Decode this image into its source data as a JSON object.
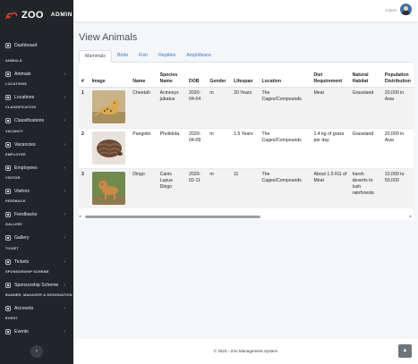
{
  "brand": {
    "logo": "ZOO",
    "admin_label": "ADMIN"
  },
  "topbar": {
    "user_name": "Admin"
  },
  "sidebar": {
    "dashboard": "Dashboard",
    "sections": [
      {
        "heading": "ANIMALS",
        "item": "Animals"
      },
      {
        "heading": "LOCATIONS",
        "item": "Locations"
      },
      {
        "heading": "CLASSIFICATION",
        "item": "Classifications"
      },
      {
        "heading": "VACANCY",
        "item": "Vacancies"
      },
      {
        "heading": "EMPLOYEE",
        "item": "Employees"
      },
      {
        "heading": "VISITOR",
        "item": "Visitors"
      },
      {
        "heading": "FEEDBACK",
        "item": "Feedbacks"
      },
      {
        "heading": "GALLERY",
        "item": "Gallery"
      },
      {
        "heading": "TICKET",
        "item": "Tickets"
      },
      {
        "heading": "SPONSORSHIP SCHEME",
        "item": "Sponsorship Scheme"
      },
      {
        "heading": "BANNER, MANAGER & DESIGNATION",
        "item": "Accounts"
      },
      {
        "heading": "EVENT",
        "item": "Events"
      }
    ],
    "collapse_glyph": "‹"
  },
  "page": {
    "title": "View Animals",
    "tabs": [
      "Mammals",
      "Birds",
      "Fish",
      "Reptiles",
      "Amphibians"
    ],
    "active_tab": 0
  },
  "table": {
    "headers": [
      "#",
      "Image",
      "Name",
      "Species Name",
      "DOB",
      "Gender",
      "Lifespan",
      "Location",
      "Diet Requirement",
      "Natural Habitat",
      "Population Distribution"
    ],
    "rows": [
      {
        "num": "1",
        "image": "cheetah",
        "name": "Cheetah",
        "species": "Acinonyx jubatus",
        "dob": "2020-04-04",
        "gender": "m",
        "lifespan": "20 Years",
        "location": "The Cages/Compounds",
        "diet": "Meat",
        "habitat": "Grassland",
        "population": "20,000 in Asia"
      },
      {
        "num": "2",
        "image": "pangolin",
        "name": "Pangolin",
        "species": "Pholidota",
        "dob": "2020-04-09",
        "gender": "m",
        "lifespan": "1.5 Years",
        "location": "The Cages/Compounds",
        "diet": "1.4 kg of grass per day",
        "habitat": "Grassland",
        "population": "20,000 in Asia"
      },
      {
        "num": "3",
        "image": "dingo",
        "name": "Dingo",
        "species": "Canis Lupus Dingo",
        "dob": "2020-02-11",
        "gender": "m",
        "lifespan": "11",
        "location": "The Cages/Compounds",
        "diet": "About 1.5 KG of Meat",
        "habitat": "harsh deserts to lush rainforests",
        "population": "10,000 to 50,000"
      }
    ]
  },
  "scroll": {
    "left_glyph": "◂",
    "right_glyph": "▸"
  },
  "footer": {
    "text": "© 2023 - Zoo Management System"
  },
  "to_top_glyph": "▲"
}
